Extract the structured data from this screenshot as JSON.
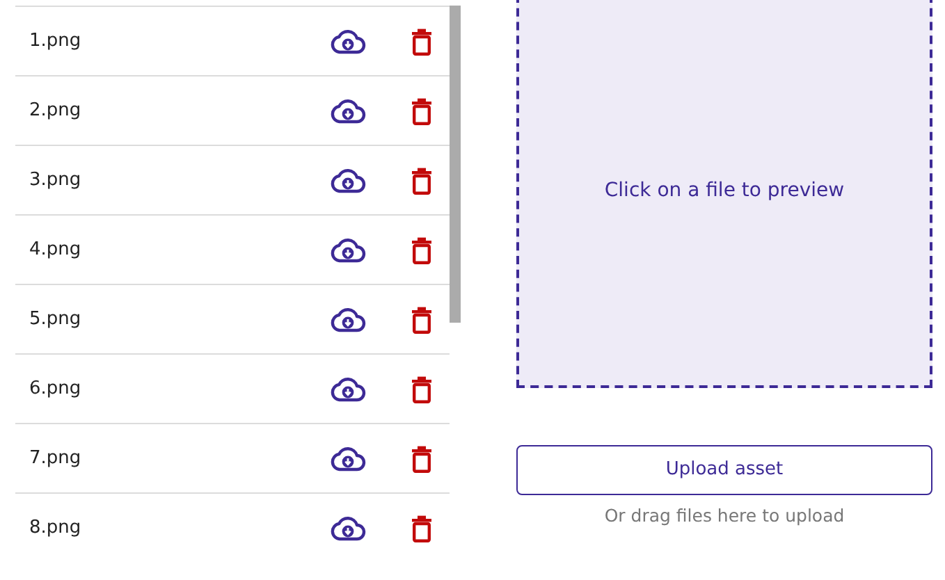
{
  "files": [
    {
      "name": "1.png"
    },
    {
      "name": "2.png"
    },
    {
      "name": "3.png"
    },
    {
      "name": "4.png"
    },
    {
      "name": "5.png"
    },
    {
      "name": "6.png"
    },
    {
      "name": "7.png"
    },
    {
      "name": "8.png"
    }
  ],
  "preview": {
    "message": "Click on a file to preview"
  },
  "upload": {
    "button": "Upload asset",
    "hint": "Or drag files here to upload"
  }
}
